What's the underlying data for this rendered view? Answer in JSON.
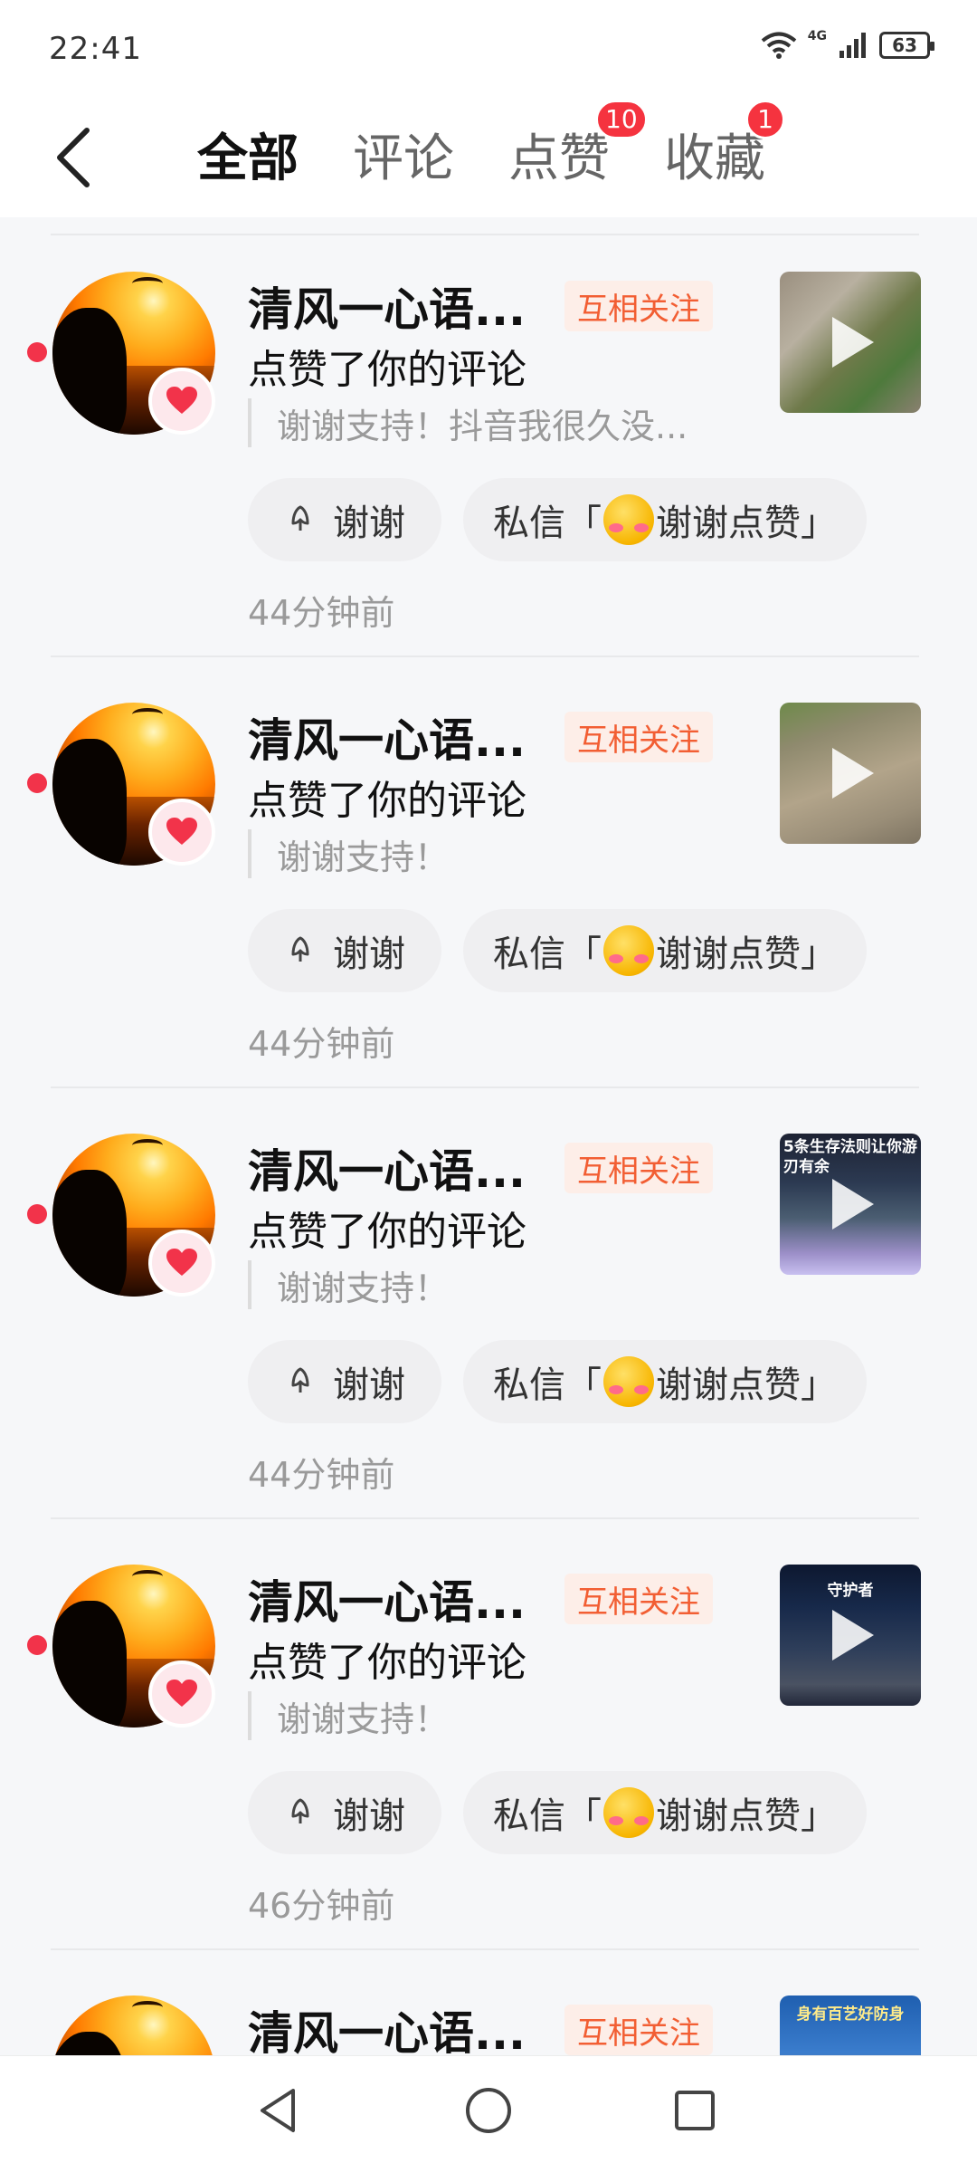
{
  "status_bar": {
    "time": "22:41",
    "network": "4G",
    "battery": "63"
  },
  "header": {
    "tabs": [
      {
        "label": "全部",
        "active": true,
        "badge": ""
      },
      {
        "label": "评论",
        "active": false,
        "badge": ""
      },
      {
        "label": "点赞",
        "active": false,
        "badge": "10"
      },
      {
        "label": "收藏",
        "active": false,
        "badge": "1"
      }
    ]
  },
  "notifications": [
    {
      "username": "清风一心语...",
      "relation": "互相关注",
      "action": "点赞了你的评论",
      "quote": "谢谢支持！抖音我很久没...",
      "thanks_label": "谢谢",
      "msg_prefix": "私信「",
      "msg_suffix": "谢谢点赞」",
      "time": "44分钟前",
      "thumb_text": ""
    },
    {
      "username": "清风一心语...",
      "relation": "互相关注",
      "action": "点赞了你的评论",
      "quote": "谢谢支持！",
      "thanks_label": "谢谢",
      "msg_prefix": "私信「",
      "msg_suffix": "谢谢点赞」",
      "time": "44分钟前",
      "thumb_text": ""
    },
    {
      "username": "清风一心语...",
      "relation": "互相关注",
      "action": "点赞了你的评论",
      "quote": "谢谢支持！",
      "thanks_label": "谢谢",
      "msg_prefix": "私信「",
      "msg_suffix": "谢谢点赞」",
      "time": "44分钟前",
      "thumb_text": "5条生存法则让你游刃有余"
    },
    {
      "username": "清风一心语...",
      "relation": "互相关注",
      "action": "点赞了你的评论",
      "quote": "谢谢支持！",
      "thanks_label": "谢谢",
      "msg_prefix": "私信「",
      "msg_suffix": "谢谢点赞」",
      "time": "46分钟前",
      "thumb_text": "守护者"
    },
    {
      "username": "清风一心语...",
      "relation": "互相关注",
      "action": "",
      "quote": "",
      "thanks_label": "",
      "msg_prefix": "",
      "msg_suffix": "",
      "time": "",
      "thumb_text": "身有百艺好防身"
    }
  ],
  "icons": {
    "back": "back-arrow-icon",
    "heart": "heart-icon",
    "thanks": "flower-icon",
    "play": "play-icon",
    "nav_back": "triangle-back-icon",
    "nav_home": "circle-home-icon",
    "nav_recent": "square-recent-icon"
  },
  "colors": {
    "accent_red": "#f2334a",
    "mutual_text": "#f25e33",
    "mutual_bg": "#fdeee8"
  }
}
